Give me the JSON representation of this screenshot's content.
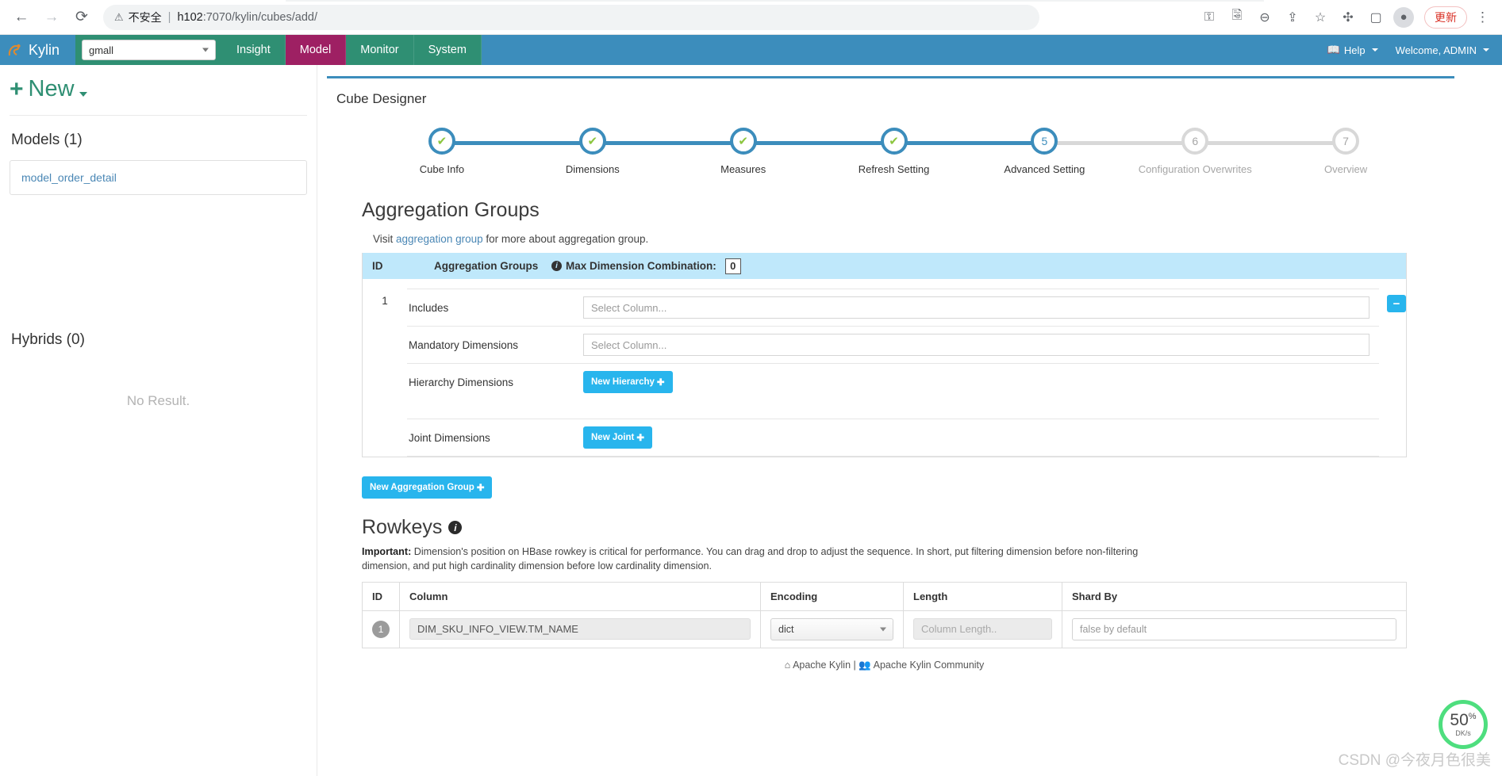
{
  "browser": {
    "back_icon": "arrow-left-icon",
    "forward_icon": "arrow-right-icon",
    "reload_icon": "reload-icon",
    "security_icon": "warning-triangle-icon",
    "security_label": "不安全",
    "separator": "|",
    "url_host": "h102",
    "url_rest": ":7070/kylin/cubes/add/",
    "actions": [
      {
        "name": "password-key-icon",
        "glyph": "⚷"
      },
      {
        "name": "translate-icon",
        "glyph": "文"
      },
      {
        "name": "zoom-out-icon",
        "glyph": "⊖"
      },
      {
        "name": "share-icon",
        "glyph": "↪"
      },
      {
        "name": "bookmark-star-icon",
        "glyph": "☆"
      },
      {
        "name": "extensions-puzzle-icon",
        "glyph": "🧩"
      },
      {
        "name": "side-panel-icon",
        "glyph": "▢"
      }
    ],
    "profile_icon": "user-avatar-icon",
    "update_label": "更新",
    "menu_icon": "kebab-menu-icon"
  },
  "navbar": {
    "brand": "Kylin",
    "project_value": "gmall",
    "items": [
      {
        "label": "Insight",
        "active": false
      },
      {
        "label": "Model",
        "active": true
      },
      {
        "label": "Monitor",
        "active": false
      },
      {
        "label": "System",
        "active": false
      }
    ],
    "help_label": "Help",
    "user_label": "Welcome, ADMIN",
    "active_color": "#9e2063",
    "nav_green": "#2f8f73",
    "bar_blue": "#3c8dbc"
  },
  "sidebar": {
    "new_label": "New",
    "models_heading": "Models (1)",
    "models": [
      "model_order_detail"
    ],
    "hybrids_heading": "Hybrids (0)",
    "no_result": "No Result."
  },
  "designer": {
    "title": "Cube Designer",
    "steps": [
      {
        "num": "1",
        "label": "Cube Info",
        "state": "done"
      },
      {
        "num": "2",
        "label": "Dimensions",
        "state": "done"
      },
      {
        "num": "3",
        "label": "Measures",
        "state": "done"
      },
      {
        "num": "4",
        "label": "Refresh Setting",
        "state": "done"
      },
      {
        "num": "5",
        "label": "Advanced Setting",
        "state": "current"
      },
      {
        "num": "6",
        "label": "Configuration Overwrites",
        "state": "todo"
      },
      {
        "num": "7",
        "label": "Overview",
        "state": "todo"
      }
    ]
  },
  "aggregation": {
    "section_title": "Aggregation Groups",
    "visit_prefix": "Visit ",
    "visit_link": "aggregation group",
    "visit_suffix": " for more about aggregation group.",
    "header": {
      "id": "ID",
      "groups": "Aggregation Groups",
      "max_combo_label": "Max Dimension Combination:",
      "max_combo_value": "0"
    },
    "group_id": "1",
    "rows": [
      {
        "label": "Includes",
        "type": "input",
        "placeholder": "Select Column..."
      },
      {
        "label": "Mandatory Dimensions",
        "type": "input",
        "placeholder": "Select Column..."
      },
      {
        "label": "Hierarchy Dimensions",
        "type": "button",
        "button": "New Hierarchy"
      },
      {
        "label": "Joint Dimensions",
        "type": "button",
        "button": "New Joint"
      }
    ],
    "remove_icon": "minus-icon",
    "new_group_button": "New Aggregation Group"
  },
  "rowkeys": {
    "title": "Rowkeys",
    "info_icon": "info-icon",
    "important_label": "Important:",
    "important_text": " Dimension's position on HBase rowkey is critical for performance. You can drag and drop to adjust the sequence. In short, put filtering dimension before non-filtering dimension, and put high cardinality dimension before low cardinality dimension.",
    "columns": [
      "ID",
      "Column",
      "Encoding",
      "Length",
      "Shard By"
    ],
    "rows": [
      {
        "id": "1",
        "column": "DIM_SKU_INFO_VIEW.TM_NAME",
        "encoding": "dict",
        "length_placeholder": "Column Length..",
        "shard_by": "false by default"
      }
    ]
  },
  "footer": {
    "home_icon": "home-icon",
    "apache_kylin": "Apache Kylin",
    "separator": "|",
    "community_icon": "community-icon",
    "community": "Apache Kylin Community"
  },
  "overlay": {
    "watermark": "CSDN @今夜月色很美",
    "speed_value": "50",
    "speed_suffix": "%",
    "speed_unit": "DK/s",
    "accent_green": "#4ede7e"
  }
}
